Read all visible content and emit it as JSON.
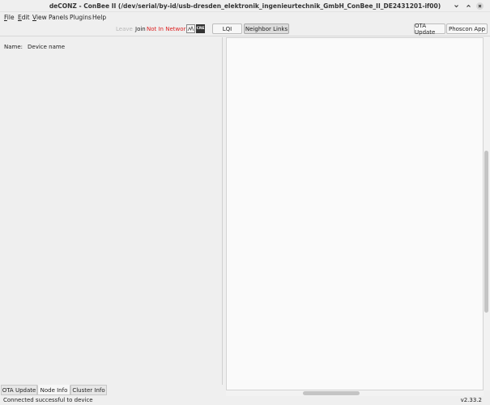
{
  "window": {
    "title": "deCONZ - ConBee II (/dev/serial/by-id/usb-dresden_elektronik_ingenieurtechnik_GmbH_ConBee_II_DE2431201-if00)",
    "controls": [
      "minimize",
      "maximize",
      "close"
    ]
  },
  "menubar": {
    "items": [
      {
        "label": "File",
        "mnemonic": "F",
        "rest": "ile"
      },
      {
        "label": "Edit",
        "mnemonic": "E",
        "rest": "dit"
      },
      {
        "label": "View",
        "mnemonic": "V",
        "rest": "iew"
      },
      {
        "label": "Panels",
        "mnemonic": "",
        "rest": "Panels"
      },
      {
        "label": "Plugins",
        "mnemonic": "",
        "rest": "Plugins"
      },
      {
        "label": "Help",
        "mnemonic": "",
        "rest": "Help"
      }
    ]
  },
  "toolbar": {
    "leave": "Leave",
    "join": "Join",
    "network_status": "Not In Network",
    "cre_icon_text": "CRE",
    "lqi": "LQI",
    "neighbor_links": "Neighbor Links",
    "ota_update": "OTA Update",
    "phoscon_app": "Phoscon App"
  },
  "node_info": {
    "name_label": "Name:",
    "name_value": "Device name"
  },
  "tabs": [
    {
      "label": "OTA Update",
      "active": false
    },
    {
      "label": "Node Info",
      "active": true
    },
    {
      "label": "Cluster Info",
      "active": false
    }
  ],
  "statusbar": {
    "message": "Connected successful to device",
    "version": "v2.33.2"
  },
  "colors": {
    "not_in_network": "#dd2222",
    "background": "#efefef",
    "canvas": "#fafafa"
  }
}
